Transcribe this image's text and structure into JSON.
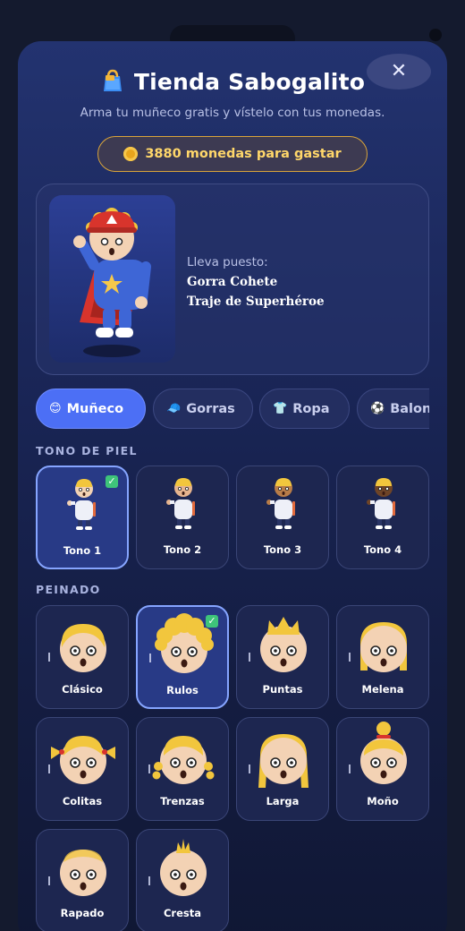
{
  "header": {
    "title": "Tienda Sabogalito",
    "subtitle": "Arma tu muñeco gratis y vístelo con tus monedas.",
    "close_glyph": "✕",
    "bag_icon": "shopping-bag-icon"
  },
  "wallet": {
    "label": "3880 monedas para gastar",
    "coin_icon": "coin-icon"
  },
  "preview": {
    "wearing_label": "Lleva puesto:",
    "items": [
      "Gorra Cohete",
      "Traje de Superhéroe"
    ]
  },
  "tabs": [
    {
      "icon": "😊",
      "label": "Muñeco",
      "active": true
    },
    {
      "icon": "🧢",
      "label": "Gorras",
      "active": false
    },
    {
      "icon": "👕",
      "label": "Ropa",
      "active": false
    },
    {
      "icon": "⚽",
      "label": "Balones",
      "active": false
    }
  ],
  "skin_section": {
    "title": "TONO DE PIEL",
    "options": [
      {
        "label": "Tono 1",
        "color": "#f3d2b4",
        "selected": true
      },
      {
        "label": "Tono 2",
        "color": "#e6b48e",
        "selected": false
      },
      {
        "label": "Tono 3",
        "color": "#b87c48",
        "selected": false
      },
      {
        "label": "Tono 4",
        "color": "#6e4427",
        "selected": false
      }
    ]
  },
  "hair_section": {
    "title": "PEINADO",
    "options": [
      {
        "label": "Clásico",
        "selected": false
      },
      {
        "label": "Rulos",
        "selected": true
      },
      {
        "label": "Puntas",
        "selected": false
      },
      {
        "label": "Melena",
        "selected": false
      },
      {
        "label": "Colitas",
        "selected": false
      },
      {
        "label": "Trenzas",
        "selected": false
      },
      {
        "label": "Larga",
        "selected": false
      },
      {
        "label": "Moño",
        "selected": false
      },
      {
        "label": "Rapado",
        "selected": false
      },
      {
        "label": "Cresta",
        "selected": false
      }
    ]
  },
  "colors": {
    "accent": "#4c6ff5",
    "hair": "#f2c63d",
    "coin": "#ffd76a",
    "selected_border": "#86a5ff",
    "check": "#3ec47a"
  }
}
